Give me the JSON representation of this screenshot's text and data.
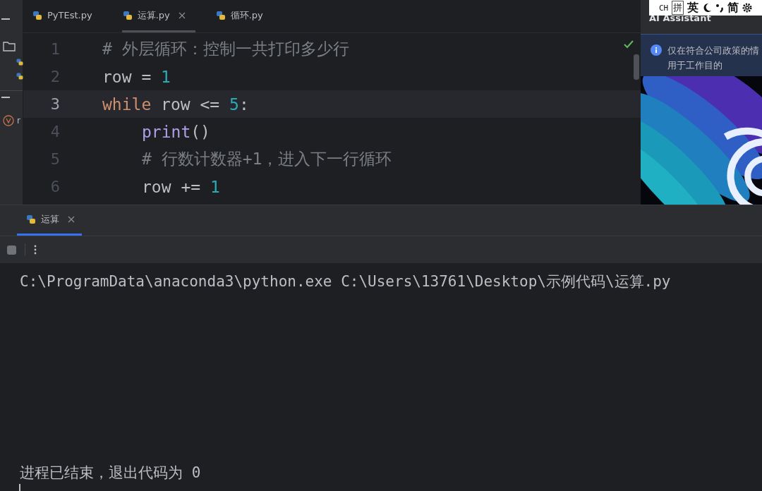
{
  "project_strip": {
    "item_label": "r"
  },
  "editor_tabs": [
    {
      "label": "PyTEst.py",
      "selected": false
    },
    {
      "label": "运算.py",
      "selected": true
    },
    {
      "label": "循环.py",
      "selected": false
    }
  ],
  "editor": {
    "lines": [
      {
        "number": "1",
        "current": false,
        "tokens": [
          {
            "kind": "comment",
            "text": "# 外层循环：控制一共打印多少行"
          }
        ]
      },
      {
        "number": "2",
        "current": false,
        "tokens": [
          {
            "kind": "ident",
            "text": "row = "
          },
          {
            "kind": "number",
            "text": "1"
          }
        ]
      },
      {
        "number": "3",
        "current": true,
        "tokens": [
          {
            "kind": "keyword",
            "text": "while "
          },
          {
            "kind": "ident",
            "text": "row <= "
          },
          {
            "kind": "number",
            "text": "5"
          },
          {
            "kind": "ident",
            "text": ":"
          }
        ],
        "children": [
          {
            "number": "4",
            "current": false,
            "tokens": [
              {
                "kind": "call",
                "text": "print"
              },
              {
                "kind": "ident",
                "text": "()"
              }
            ]
          },
          {
            "number": "5",
            "current": false,
            "tokens": [
              {
                "kind": "comment",
                "text": "# 行数计数器+1，进入下一行循环"
              }
            ]
          },
          {
            "number": "6",
            "current": false,
            "tokens": [
              {
                "kind": "ident",
                "text": "row += "
              },
              {
                "kind": "number",
                "text": "1"
              }
            ]
          }
        ]
      }
    ]
  },
  "ime_toolbar": {
    "items": [
      {
        "kind": "text",
        "text": "CH"
      },
      {
        "kind": "boxed",
        "text": "拼"
      },
      {
        "kind": "text",
        "text": "英"
      },
      {
        "kind": "moon"
      },
      {
        "kind": "punct"
      },
      {
        "kind": "text",
        "text": "简"
      },
      {
        "kind": "gear"
      }
    ]
  },
  "ai_assistant": {
    "title": "AI Assistant",
    "notice_lines": [
      "仅在符合公司政策的情",
      "用于工作目的"
    ],
    "banner": {
      "kind": "picture"
    }
  },
  "run_panel": {
    "tabs": [
      {
        "label": "运算",
        "selected": true
      }
    ],
    "console_lines": [
      {
        "kind": "command",
        "text": "C:\\ProgramData\\anaconda3\\python.exe C:\\Users\\13761\\Desktop\\示例代码\\运算.py"
      },
      {
        "kind": "status",
        "text": "进程已结束，退出代码为 0"
      }
    ]
  }
}
